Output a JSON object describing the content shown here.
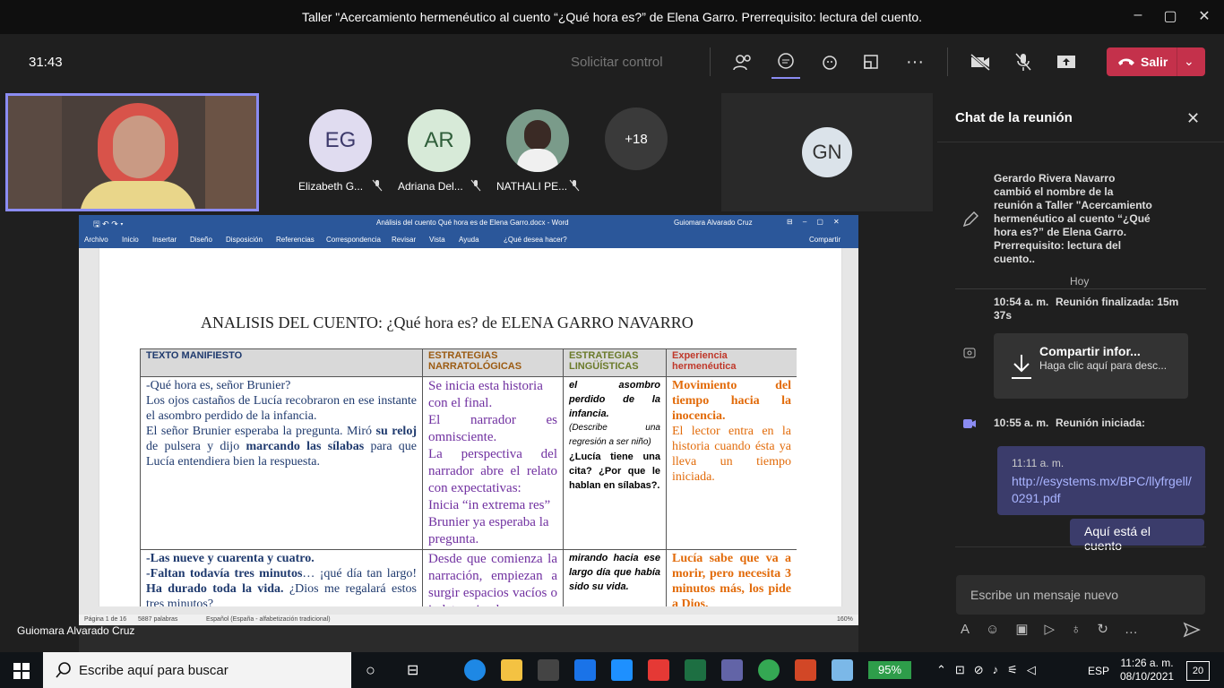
{
  "window": {
    "title": "Taller \"Acercamiento hermenéutico al cuento “¿Qué hora es?” de Elena Garro. Prerrequisito: lectura del cuento."
  },
  "toolbar": {
    "timer": "31:43",
    "request_control": "Solicitar control",
    "leave_label": "Salir"
  },
  "participants": [
    {
      "initials": "EG",
      "name": "Elizabeth G...",
      "color": "#e0dcf0",
      "text": "#3d3a6b"
    },
    {
      "initials": "AR",
      "name": "Adriana Del...",
      "color": "#d7ead8",
      "text": "#2f5e3a"
    },
    {
      "initials": "",
      "name": "NATHALI PE...",
      "color": "#6a8",
      "text": "#fff"
    },
    {
      "initials": "+18",
      "name": "",
      "color": "#3a3a3a",
      "text": "#fff"
    }
  ],
  "gn": {
    "initials": "GN"
  },
  "presenter": "Guiomara Alvarado Cruz",
  "word": {
    "doc_title": "Análisis del  cuento Qué hora es de Elena Garro.docx  -  Word",
    "user": "Guiomara Alvarado Cruz",
    "menu": [
      "Archivo",
      "Inicio",
      "Insertar",
      "Diseño",
      "Disposición",
      "Referencias",
      "Correspondencia",
      "Revisar",
      "Vista",
      "Ayuda",
      "¿Qué desea hacer?",
      "Compartir"
    ],
    "heading": "ANALISIS DEL CUENTO: ¿Qué hora es? de ELENA GARRO NAVARRO",
    "headers": [
      "TEXTO MANIFIESTO",
      "ESTRATEGIAS NARRATOLÓGICAS",
      "ESTRATEGIAS LINGÜÍSTICAS",
      "Experiencia hermenéutica"
    ],
    "row1": {
      "c1a": "-Qué hora es, señor Brunier?",
      "c1b": "Los ojos castaños de Lucía recobraron en  ese instante el asombro perdido de la infancia.",
      "c1c": "El señor Brunier esperaba la pregunta. Miró ",
      "c1d": "su reloj",
      "c1e": " de pulsera  y dijo ",
      "c1f": "marcando las sílabas",
      "c1g": " para que Lucía entendiera bien la respuesta.",
      "c2": "Se inicia esta historia con el final.",
      "c2b": "El narrador es omnisciente.",
      "c2c": "La perspectiva del narrador abre el relato con expectativas:",
      "c2d": "Inicia “in extrema res” Brunier ya esperaba la pregunta.",
      "c3a": "el asombro perdido de la infancia",
      "c3b": "(Describe una regresión a ser niño)",
      "c3c": "¿Lucía tiene una cita? ¿Por que le hablan en sílabas?.",
      "c4a": "Movimiento del tiempo hacia la inocencia.",
      "c4b": "El lector entra en la historia cuando ésta ya lleva un tiempo iniciada."
    },
    "row2": {
      "c1a": "-Las nueve y cuarenta y cuatro.",
      "c1b": "-Faltan todavía tres minutos",
      "c1c": "… ¡qué día tan largo! ",
      "c1d": "Ha durado toda la vida.",
      "c1e": " ¿Dios me regalará estos tres minutos?",
      "c2": "Desde que comienza la narración, empiezan a surgir espacios vacíos o indeterminados.",
      "c3": "mirando hacia ese largo día que había sido su vida.",
      "c4": "Lucía sabe que va a morir, pero necesita 3 minutos más, los pide a Dios."
    },
    "status": {
      "page": "Página 1 de 16",
      "words": "5887 palabras",
      "lang": "Español (España - alfabetización tradicional)",
      "zoom": "160%"
    }
  },
  "chat": {
    "title": "Chat de la reunión",
    "rename": "Gerardo Rivera Navarro cambió el nombre de la reunión a Taller \"Acercamiento hermenéutico al cuento “¿Qué hora es?” de Elena Garro. Prerrequisito: lectura del cuento..",
    "today": "Hoy",
    "ended_time": "10:54 a. m.",
    "ended_text": "Reunión finalizada: 15m 37s",
    "share_title": "Compartir infor...",
    "share_sub": "Haga clic aquí para desc...",
    "started_time": "10:55 a. m.",
    "started_text": "Reunión iniciada:",
    "link_time": "11:11 a. m.",
    "link": "http://esystems.mx/BPC/llyfrgell/0291.pdf",
    "reply": "Aquí está el cuento",
    "input_placeholder": "Escribe un mensaje nuevo"
  },
  "taskbar": {
    "search": "Escribe aquí para buscar",
    "battery": "95%",
    "lang": "ESP",
    "time": "11:26 a. m.",
    "date": "08/10/2021",
    "notif": "20"
  }
}
